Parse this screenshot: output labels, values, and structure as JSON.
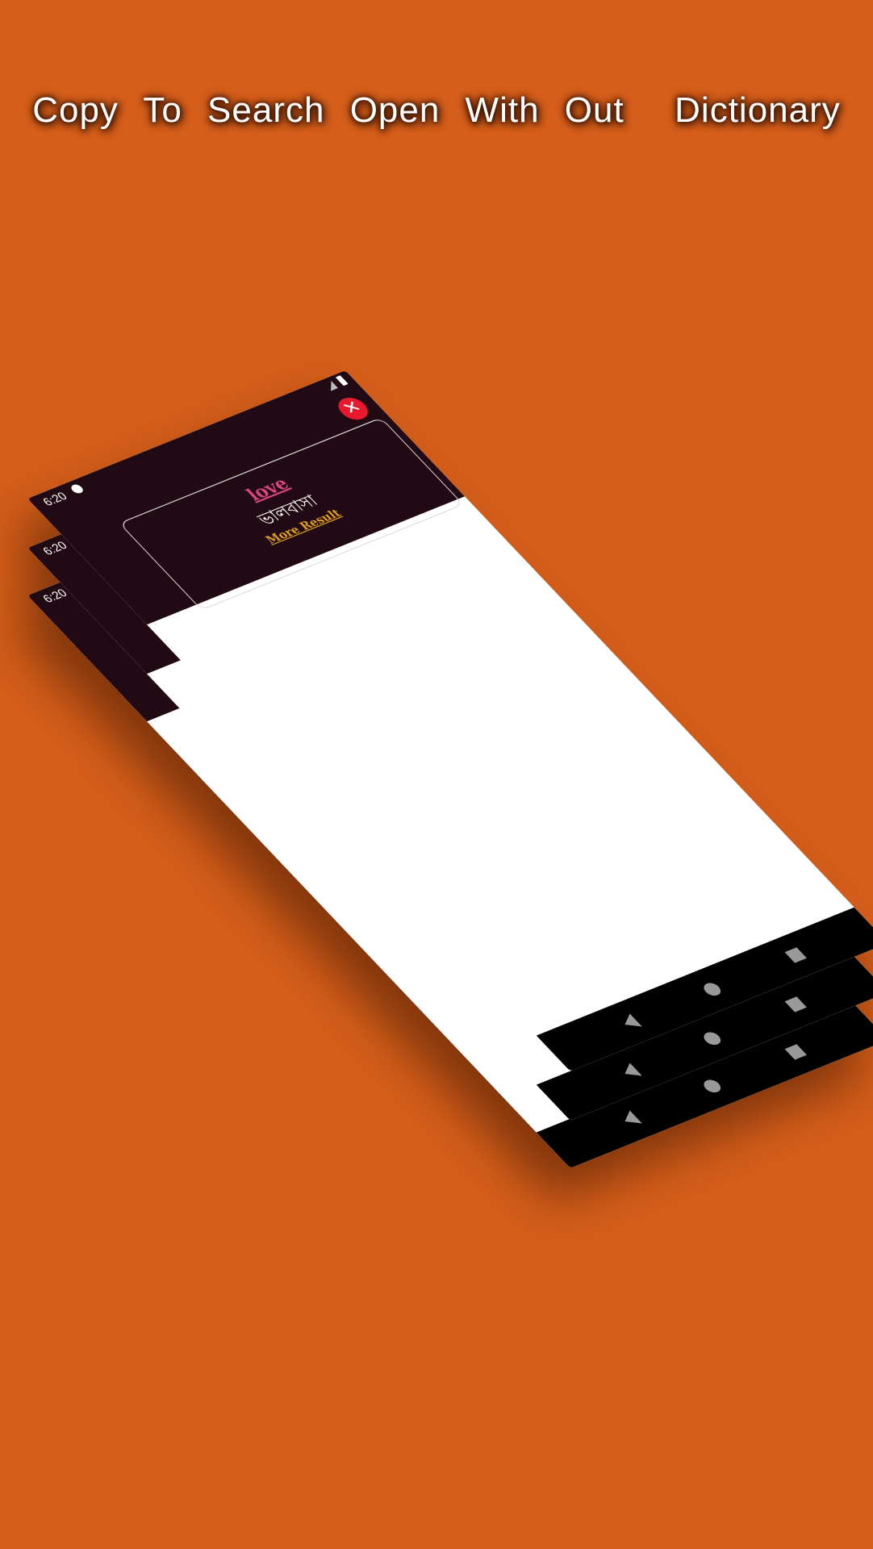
{
  "headline": "Copy To Search Open With Out  Dictionary",
  "colors": {
    "background": "#d55e1a",
    "header": "#220a14",
    "word": "#d6457a",
    "more_result": "#e0a21b",
    "close_button": "#e8192c"
  },
  "phone": {
    "status_bar": {
      "time": "6:20",
      "icons": [
        "notification-dot-icon",
        "signal-icon",
        "battery-icon"
      ]
    },
    "close_icon": "✕",
    "result": {
      "word": "love",
      "meaning": "ভালবাসা",
      "more_link": "More Result"
    },
    "nav_icons": [
      "back-icon",
      "home-icon",
      "recents-icon"
    ]
  }
}
